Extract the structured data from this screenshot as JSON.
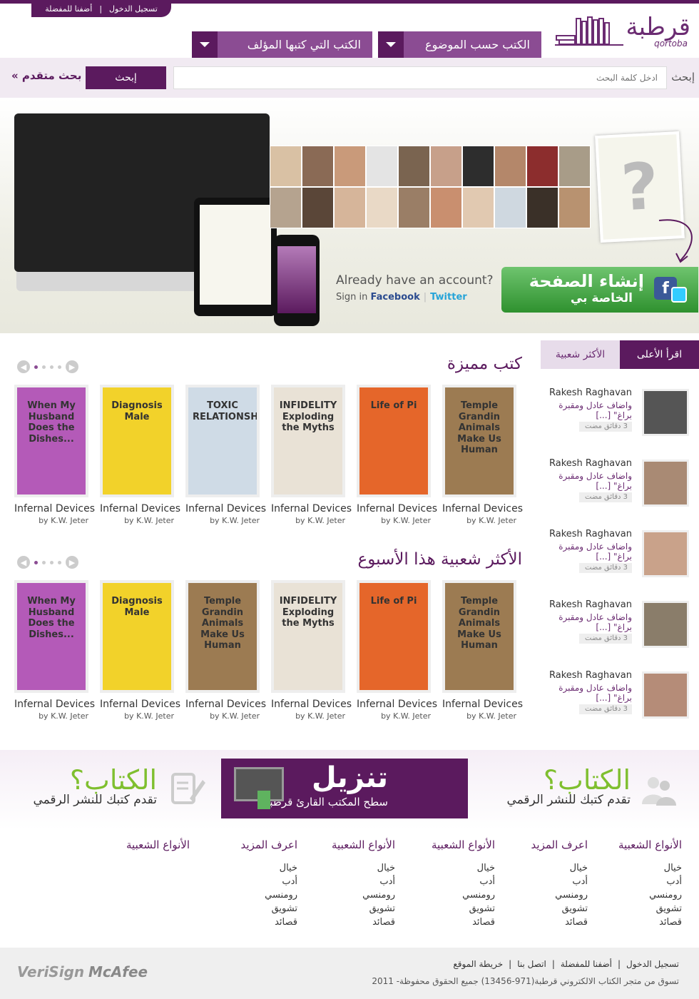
{
  "header": {
    "top_links": [
      "تسجيل الدخول",
      "أضفنا للمفضلة"
    ],
    "logo_word": "قرطبة",
    "logo_latin": "qortoba",
    "nav": [
      {
        "label": "الكتب حسب الموضوع"
      },
      {
        "label": "الكتب التي كتبها المؤلف"
      }
    ]
  },
  "search": {
    "label": "إبحث",
    "placeholder": "ادخل كلمة البحث",
    "button": "إبحث",
    "advanced": "بحث متقدم »"
  },
  "hero": {
    "already": "Already have an account?",
    "sign_in": "Sign in",
    "facebook": "Facebook",
    "separator": "|",
    "twitter": "Twitter",
    "create_line1": "إنشاء الصفحة",
    "create_line2": "الخاصة بي",
    "question_mark": "?"
  },
  "featured": {
    "title": "كتب مميزة",
    "books": [
      {
        "cover_text": "When My Husband Does the Dishes...",
        "cover_color": "#b45ab8",
        "name": "Infernal Devices",
        "author": "by K.W. Jeter"
      },
      {
        "cover_text": "Diagnosis Male",
        "cover_color": "#f2d22a",
        "name": "Infernal Devices",
        "author": "by K.W. Jeter"
      },
      {
        "cover_text": "TOXIC RELATIONSHIPS",
        "cover_color": "#cfdbe6",
        "name": "Infernal Devices",
        "author": "by K.W. Jeter"
      },
      {
        "cover_text": "INFIDELITY Exploding the Myths",
        "cover_color": "#e9e2d6",
        "name": "Infernal Devices",
        "author": "by K.W. Jeter"
      },
      {
        "cover_text": "Life of Pi",
        "cover_color": "#e5662a",
        "name": "Infernal Devices",
        "author": "by K.W. Jeter"
      },
      {
        "cover_text": "Temple Grandin Animals Make Us Human",
        "cover_color": "#9c7b52",
        "name": "Infernal Devices",
        "author": "by K.W. Jeter"
      }
    ]
  },
  "popular": {
    "title": "الأكثر شعبية هذا الأسبوع",
    "books": [
      {
        "cover_text": "When My Husband Does the Dishes...",
        "cover_color": "#b45ab8",
        "name": "Infernal Devices",
        "author": "by K.W. Jeter"
      },
      {
        "cover_text": "Diagnosis Male",
        "cover_color": "#f2d22a",
        "name": "Infernal Devices",
        "author": "by K.W. Jeter"
      },
      {
        "cover_text": "Temple Grandin Animals Make Us Human",
        "cover_color": "#9c7b52",
        "name": "Infernal Devices",
        "author": "by K.W. Jeter"
      },
      {
        "cover_text": "INFIDELITY Exploding the Myths",
        "cover_color": "#e9e2d6",
        "name": "Infernal Devices",
        "author": "by K.W. Jeter"
      },
      {
        "cover_text": "Life of Pi",
        "cover_color": "#e5662a",
        "name": "Infernal Devices",
        "author": "by K.W. Jeter"
      },
      {
        "cover_text": "Temple Grandin Animals Make Us Human",
        "cover_color": "#9c7b52",
        "name": "Infernal Devices",
        "author": "by K.W. Jeter"
      }
    ]
  },
  "sidebar": {
    "tab_active": "اقرأ الأعلى",
    "tab_other": "الأكثر شعبية",
    "items": [
      {
        "name": "Rakesh Raghavan",
        "text": "واضاف عادل ومقبرة براغ\" [...]",
        "time": "3 دقائق مضت"
      },
      {
        "name": "Rakesh Raghavan",
        "text": "واضاف عادل ومقبرة براغ\" [...]",
        "time": "3 دقائق مضت"
      },
      {
        "name": "Rakesh Raghavan",
        "text": "واضاف عادل ومقبرة براغ\" [...]",
        "time": "3 دقائق مضت"
      },
      {
        "name": "Rakesh Raghavan",
        "text": "واضاف عادل ومقبرة براغ\" [...]",
        "time": "3 دقائق مضت"
      },
      {
        "name": "Rakesh Raghavan",
        "text": "واضاف عادل ومقبرة براغ\" [...]",
        "time": "3 دقائق مضت"
      }
    ]
  },
  "promo": {
    "right_heading": "الكتاب؟",
    "right_sub": "تقدم كتبك للنشر الرقمي",
    "download_big": "تنزيل",
    "download_sub": "سطح المكتب القارئ قرطبة",
    "left_heading": "الكتاب؟",
    "left_sub": "تقدم كتبك للنشر الرقمي"
  },
  "footer_links": [
    {
      "heading": "الأنواع الشعبية",
      "items": [
        "خيال",
        "أدب",
        "رومنسي",
        "تشويق",
        "قصائد"
      ]
    },
    {
      "heading": "اعرف المزيد",
      "items": [
        "خيال",
        "أدب",
        "رومنسي",
        "تشويق",
        "قصائد"
      ]
    },
    {
      "heading": "الأنواع الشعبية",
      "items": [
        "خيال",
        "أدب",
        "رومنسي",
        "تشويق",
        "قصائد"
      ]
    },
    {
      "heading": "الأنواع الشعبية",
      "items": [
        "خيال",
        "أدب",
        "رومنسي",
        "تشويق",
        "قصائد"
      ]
    },
    {
      "heading": "اعرف المزيد",
      "items": [
        "خيال",
        "أدب",
        "رومنسي",
        "تشويق",
        "قصائد"
      ]
    },
    {
      "heading": "الأنواع الشعبية",
      "items": []
    }
  ],
  "footer": {
    "links": [
      "تسجيل الدخول",
      "|",
      "أضفنا للمفضلة",
      "|",
      "اتصل بنا",
      "|",
      "خريطة الموقع"
    ],
    "copyright": "تسوق من متجر الكتاب الالكتروني قرطبة(971-13456)  جميع الحقوق محفوظة- 2011",
    "badge_verisign": "VeriSign",
    "badge_mcafee": "McAfee"
  },
  "colors": {
    "brand": "#5b1a5e",
    "accent": "#8b4c93",
    "green": "#3aa13a"
  }
}
